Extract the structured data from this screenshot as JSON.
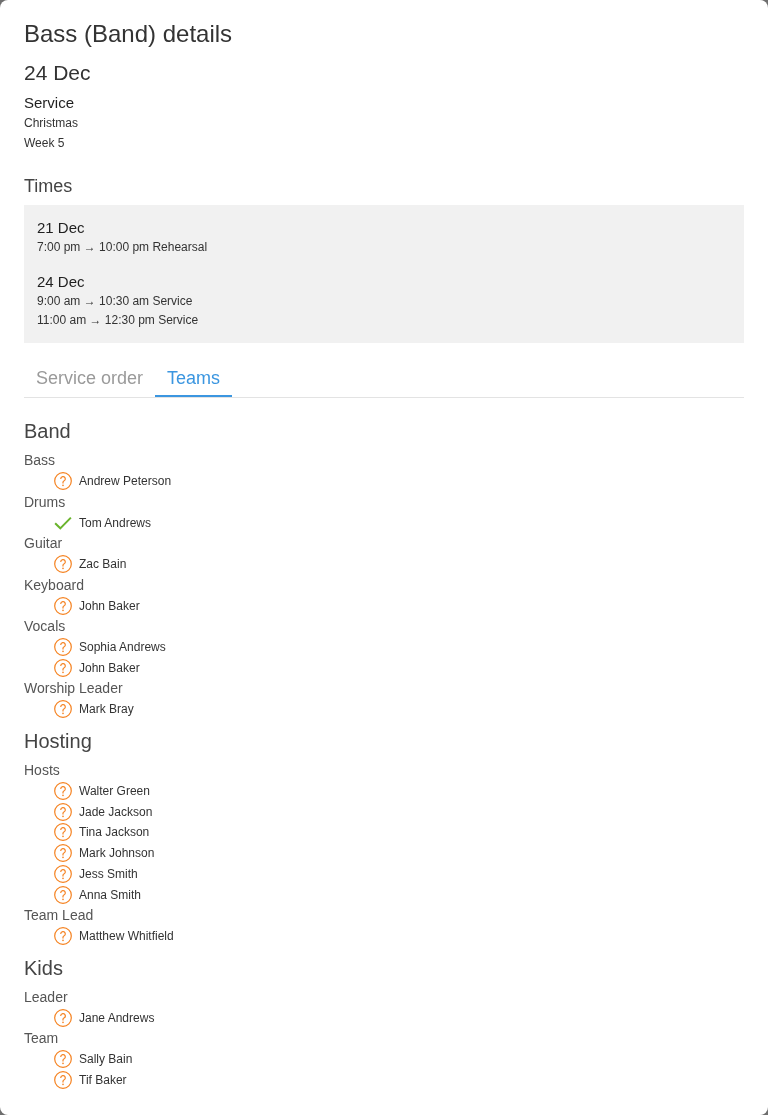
{
  "dialog": {
    "title": "Bass (Band) details"
  },
  "date": "24 Dec",
  "event": {
    "type": "Service",
    "name": "Christmas",
    "week": "Week 5"
  },
  "times": {
    "heading": "Times",
    "days": [
      {
        "date": "21 Dec",
        "slots": [
          "7:00 pm → 10:00 pm Rehearsal"
        ]
      },
      {
        "date": "24 Dec",
        "slots": [
          "9:00 am → 10:30 am Service",
          "11:00 am → 12:30 pm Service"
        ]
      }
    ]
  },
  "tabs": [
    {
      "label": "Service order",
      "selected": false
    },
    {
      "label": "Teams",
      "selected": true
    }
  ],
  "teams": [
    {
      "name": "Band",
      "roles": [
        {
          "name": "Bass",
          "members": [
            {
              "name": "Andrew Peterson",
              "confirmed": false
            }
          ]
        },
        {
          "name": "Drums",
          "members": [
            {
              "name": "Tom Andrews",
              "confirmed": true
            }
          ]
        },
        {
          "name": "Guitar",
          "members": [
            {
              "name": "Zac Bain",
              "confirmed": false
            }
          ]
        },
        {
          "name": "Keyboard",
          "members": [
            {
              "name": "John Baker",
              "confirmed": false
            }
          ]
        },
        {
          "name": "Vocals",
          "members": [
            {
              "name": "Sophia Andrews",
              "confirmed": false
            },
            {
              "name": "John Baker",
              "confirmed": false
            }
          ]
        },
        {
          "name": "Worship Leader",
          "members": [
            {
              "name": "Mark Bray",
              "confirmed": false
            }
          ]
        }
      ]
    },
    {
      "name": "Hosting",
      "roles": [
        {
          "name": "Hosts",
          "members": [
            {
              "name": "Walter Green",
              "confirmed": false
            },
            {
              "name": "Jade Jackson",
              "confirmed": false
            },
            {
              "name": "Tina Jackson",
              "confirmed": false
            },
            {
              "name": "Mark Johnson",
              "confirmed": false
            },
            {
              "name": "Jess Smith",
              "confirmed": false
            },
            {
              "name": "Anna Smith",
              "confirmed": false
            }
          ]
        },
        {
          "name": "Team Lead",
          "members": [
            {
              "name": "Matthew Whitfield",
              "confirmed": false
            }
          ]
        }
      ]
    },
    {
      "name": "Kids",
      "roles": [
        {
          "name": "Leader",
          "members": [
            {
              "name": "Jane Andrews",
              "confirmed": false
            }
          ]
        },
        {
          "name": "Team",
          "members": [
            {
              "name": "Sally Bain",
              "confirmed": false
            },
            {
              "name": "Tif Baker",
              "confirmed": false
            }
          ]
        }
      ]
    }
  ]
}
